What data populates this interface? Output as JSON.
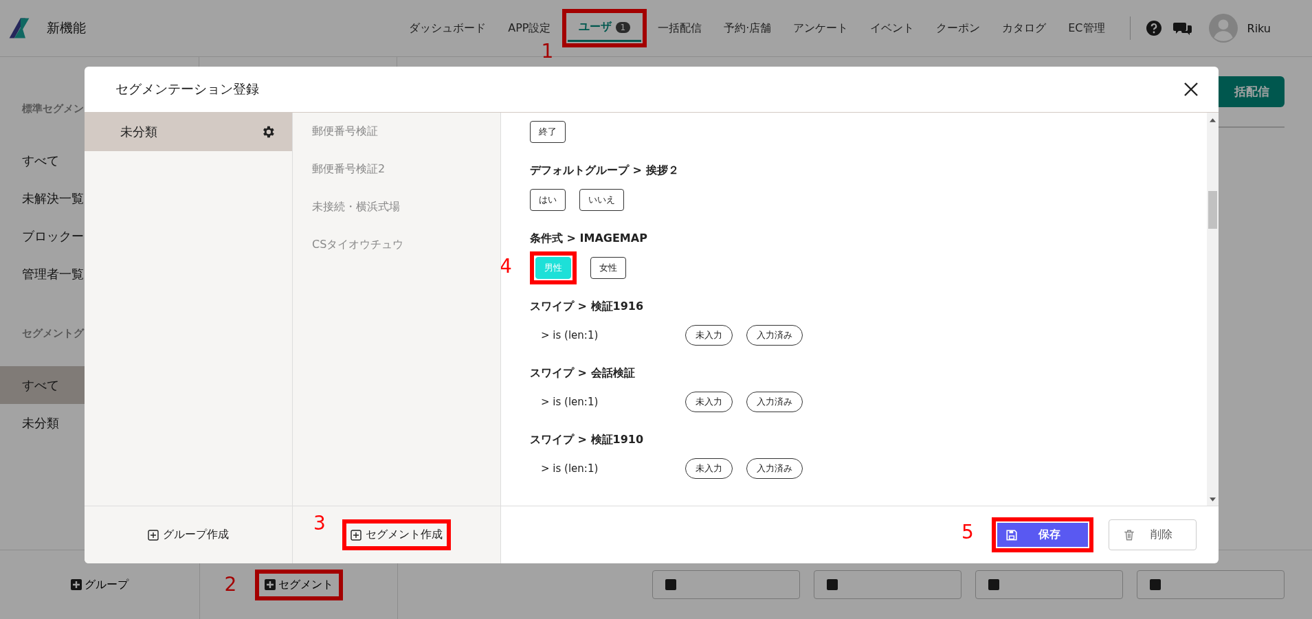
{
  "nav": {
    "logo": "新機能",
    "items": [
      {
        "label": "ダッシュボード",
        "selected": false
      },
      {
        "label": "APP設定",
        "selected": false
      },
      {
        "label": "ユーザ",
        "selected": true,
        "badge": "1",
        "callout": "1"
      },
      {
        "label": "一括配信",
        "selected": false
      },
      {
        "label": "予約·店舗",
        "selected": false
      },
      {
        "label": "アンケート",
        "selected": false
      },
      {
        "label": "イベント",
        "selected": false
      },
      {
        "label": "クーポン",
        "selected": false
      },
      {
        "label": "カタログ",
        "selected": false
      },
      {
        "label": "EC管理",
        "selected": false
      }
    ],
    "user": "Riku"
  },
  "sidebar": {
    "sections": [
      {
        "heading": "標準セグメン",
        "items": [
          {
            "label": "すべて",
            "selected": false
          },
          {
            "label": "未解決一覧",
            "selected": false
          },
          {
            "label": "ブロックー",
            "selected": false
          },
          {
            "label": "管理者一覧",
            "selected": false
          }
        ]
      },
      {
        "heading": "セグメントグ",
        "items": [
          {
            "label": "すべて",
            "selected": true
          },
          {
            "label": "未分類",
            "selected": false
          }
        ]
      }
    ]
  },
  "broadcast_button": "括配信",
  "page_footer": {
    "group_button": "グループ",
    "segment_button": {
      "label": "セグメント",
      "callout": "2"
    },
    "buttons": [
      {
        "kind": "csv"
      },
      {
        "kind": "csv"
      },
      {
        "kind": "csv"
      },
      {
        "kind": "csv"
      }
    ]
  },
  "modal": {
    "title": "セグメンテーション登録",
    "groups": [
      {
        "label": "未分類",
        "selected": true
      }
    ],
    "segments": [
      {
        "label": "郵便番号検証"
      },
      {
        "label": "郵便番号検証2"
      },
      {
        "label": "未接続・横浜式場"
      },
      {
        "label": "CSタイオウチュウ"
      }
    ],
    "sections": [
      {
        "rows": [
          {
            "options": [
              {
                "label": "終了",
                "selected": false,
                "kind": "box"
              }
            ]
          }
        ]
      },
      {
        "title": "デフォルトグループ > 挨拶２",
        "rows": [
          {
            "options": [
              {
                "label": "はい",
                "selected": false,
                "kind": "box"
              },
              {
                "label": "いいえ",
                "selected": false,
                "kind": "box"
              }
            ]
          }
        ]
      },
      {
        "title": "条件式 > IMAGEMAP",
        "rows": [
          {
            "options": [
              {
                "label": "男性",
                "selected": true,
                "kind": "box",
                "callout": "4"
              },
              {
                "label": "女性",
                "selected": false,
                "kind": "box"
              }
            ]
          }
        ]
      },
      {
        "title": "スワイプ > 検証1916",
        "rows": [
          {
            "label": "> is (len:1)",
            "options": [
              {
                "label": "未入力",
                "selected": false,
                "kind": "pill"
              },
              {
                "label": "入力済み",
                "selected": false,
                "kind": "pill"
              }
            ]
          }
        ]
      },
      {
        "title": "スワイプ > 会話検証",
        "rows": [
          {
            "label": "> is (len:1)",
            "options": [
              {
                "label": "未入力",
                "selected": false,
                "kind": "pill"
              },
              {
                "label": "入力済み",
                "selected": false,
                "kind": "pill"
              }
            ]
          }
        ]
      },
      {
        "title": "スワイプ > 検証1910",
        "rows": [
          {
            "label": "> is (len:1)",
            "options": [
              {
                "label": "未入力",
                "selected": false,
                "kind": "pill"
              },
              {
                "label": "入力済み",
                "selected": false,
                "kind": "pill"
              }
            ]
          }
        ]
      }
    ],
    "footer": {
      "group_create": "グループ作成",
      "segment_create": {
        "label": "セグメント作成",
        "callout": "3"
      },
      "save": {
        "label": "保存",
        "callout": "5"
      },
      "delete": "削除"
    }
  }
}
